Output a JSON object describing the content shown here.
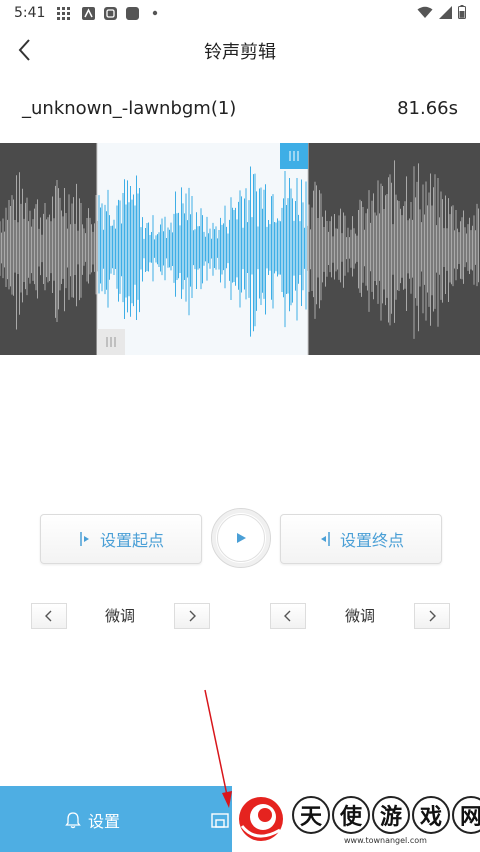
{
  "status": {
    "time": "5:41"
  },
  "header": {
    "title": "铃声剪辑"
  },
  "file": {
    "name": "_unknown_-lawnbgm(1)",
    "duration": "81.66s"
  },
  "controls": {
    "set_start_label": "设置起点",
    "set_end_label": "设置终点",
    "fine_label_left": "微调",
    "fine_label_right": "微调"
  },
  "bottom": {
    "settings_label": "设置"
  },
  "watermark": {
    "chars": [
      "天",
      "使",
      "游",
      "戏",
      "网"
    ],
    "url": "www.townangel.com"
  },
  "colors": {
    "accent": "#4eaee3",
    "wave_selected": "#3eaee6",
    "wave_unselected": "#a9a9a9",
    "wave_bg_dark": "#4b4b4b"
  },
  "icons": [
    "back-arrow-icon",
    "play-icon",
    "set-start-icon",
    "set-end-icon",
    "chevron-left-icon",
    "chevron-right-icon",
    "bell-icon",
    "save-icon"
  ]
}
